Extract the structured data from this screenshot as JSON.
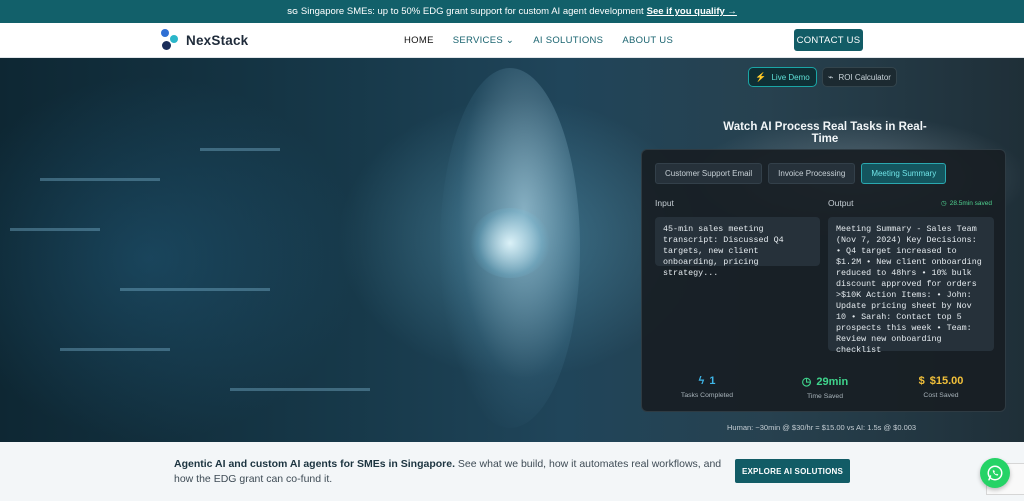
{
  "announcement": {
    "flag": "SG",
    "text": "Singapore SMEs: up to 50% EDG grant support for custom AI agent development",
    "link": "See if you qualify →"
  },
  "nav": {
    "brand": "NexStack",
    "items": [
      "HOME",
      "SERVICES ⌄",
      "AI SOLUTIONS",
      "ABOUT US"
    ],
    "active_item": "HOME",
    "cta": "CONTACT US"
  },
  "hero": {
    "chips": {
      "live_demo": "Live Demo",
      "roi": "ROI Calculator"
    },
    "title": "Watch AI Process Real Tasks in Real-Time",
    "demo": {
      "tabs": [
        "Customer Support Email",
        "Invoice Processing",
        "Meeting Summary"
      ],
      "active_tab": "Meeting Summary",
      "saved": "28.5min saved",
      "input_label": "Input",
      "output_label": "Output",
      "input_text": "45-min sales meeting transcript: Discussed Q4 targets, new client onboarding, pricing strategy...",
      "output_text": "Meeting Summary - Sales Team (Nov 7, 2024) Key Decisions: • Q4 target increased to $1.2M • New client onboarding reduced to 48hrs • 10% bulk discount approved for orders >$10K Action Items: • John: Update pricing sheet by Nov 10 • Sarah: Contact top 5 prospects this week • Team: Review new onboarding checklist",
      "stats": [
        {
          "value": "1",
          "label": "Tasks Completed",
          "icon": "lightning-icon"
        },
        {
          "value": "29min",
          "label": "Time Saved",
          "icon": "clock-icon"
        },
        {
          "value": "$15.00",
          "label": "Cost Saved",
          "icon": "dollar-icon"
        }
      ]
    },
    "comparison": "Human: ~30min @ $30/hr = $15.00  vs  AI: 1.5s @ $0.003"
  },
  "bottom": {
    "headline": "Agentic AI and custom AI agents for SMEs in Singapore.",
    "body": " See what we build, how it automates real workflows, and how the EDG grant can co-fund it.",
    "cta": "EXPLORE AI SOLUTIONS"
  },
  "colors": {
    "brand": "#125c66",
    "accent": "#2aa8b0",
    "announce_bg": "#12606a"
  }
}
